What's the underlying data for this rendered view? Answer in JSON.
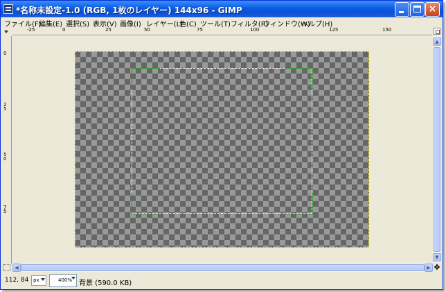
{
  "window": {
    "title": "*名称未設定-1.0 (RGB, 1枚のレイヤー) 144x96 - GIMP",
    "minimize_icon": "minimize-icon",
    "maximize_icon": "maximize-icon",
    "close_icon": "close-icon",
    "close_glyph": "×"
  },
  "menu": [
    "ファイル(F)",
    "編集(E)",
    "選択(S)",
    "表示(V)",
    "画像(I)",
    "レイヤー(L)",
    "色(C)",
    "ツール(T)",
    "フィルタ(R)",
    "ウィンドウ(W)",
    "ヘルプ(H)"
  ],
  "ruler": {
    "h_labels": [
      "-25",
      "0",
      "25",
      "50",
      "75",
      "100",
      "125",
      "150"
    ],
    "v_labels": [
      "0",
      "25",
      "50",
      "75"
    ]
  },
  "canvas": {
    "image_label": "checkerboard transparency",
    "selection_color": "#ffffff",
    "guide_color": "#2a9a2a",
    "border_color": "#e8d400"
  },
  "status": {
    "pointer_coords": "112, 84",
    "unit": "px",
    "zoom": "400%",
    "layer_info": "背景 (590.0 KB)"
  },
  "nav_icon": "✥"
}
